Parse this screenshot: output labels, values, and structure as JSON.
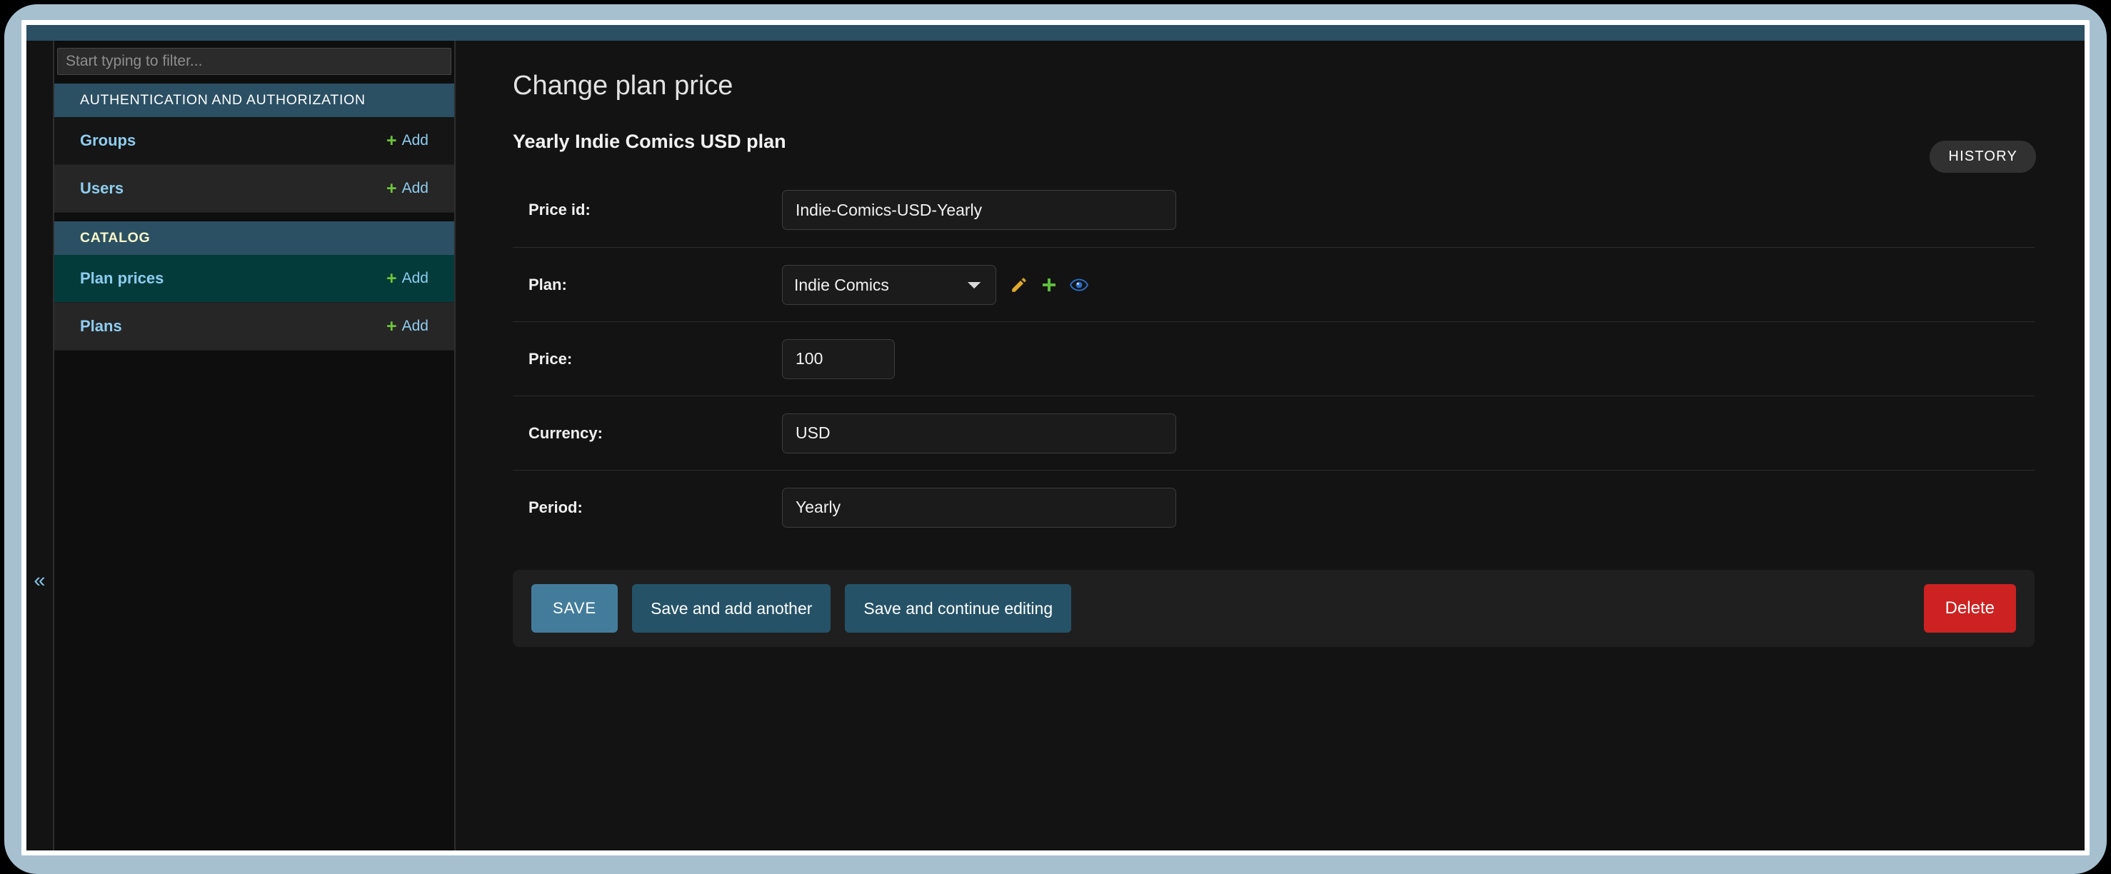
{
  "window": {
    "frame_color": "#a6c0d0",
    "header_strip_color": "#2b4f63"
  },
  "sidebar": {
    "filter_placeholder": "Start typing to filter...",
    "filter_value": "",
    "collapse_icon": "«",
    "add_label": "Add",
    "plus_glyph": "+",
    "groups": [
      {
        "header": "AUTHENTICATION AND AUTHORIZATION",
        "header_color": "#ffffff",
        "items": [
          {
            "label": "Groups",
            "add": "Add",
            "current": false
          },
          {
            "label": "Users",
            "add": "Add",
            "current": false
          }
        ]
      },
      {
        "header": "CATALOG",
        "header_color": "#f8f8c8",
        "items": [
          {
            "label": "Plan prices",
            "add": "Add",
            "current": true
          },
          {
            "label": "Plans",
            "add": "Add",
            "current": false
          }
        ]
      }
    ]
  },
  "main": {
    "page_title": "Change plan price",
    "history_label": "HISTORY",
    "object_subtitle": "Yearly Indie Comics USD plan",
    "fields": [
      {
        "key": "price_id",
        "label": "Price id:",
        "type": "text",
        "value": "Indie-Comics-USD-Yearly",
        "size": "wide"
      },
      {
        "key": "plan",
        "label": "Plan:",
        "type": "select",
        "value": "Indie Comics",
        "options": [
          "Indie Comics"
        ],
        "related_widgets": [
          {
            "name": "change-related-icon",
            "title": "Change selected plan",
            "color": "#e0a82e"
          },
          {
            "name": "add-related-icon",
            "title": "Add another plan",
            "color": "#5fbd3f"
          },
          {
            "name": "view-related-icon",
            "title": "View selected plan",
            "color": "#2a6fc4"
          }
        ]
      },
      {
        "key": "price",
        "label": "Price:",
        "type": "text",
        "value": "100",
        "size": "small"
      },
      {
        "key": "currency",
        "label": "Currency:",
        "type": "text",
        "value": "USD",
        "size": "wide"
      },
      {
        "key": "period",
        "label": "Period:",
        "type": "text",
        "value": "Yearly",
        "size": "wide"
      }
    ],
    "submit_row": {
      "save": "SAVE",
      "save_and_add_another": "Save and add another",
      "save_and_continue": "Save and continue editing",
      "delete": "Delete"
    }
  },
  "colors": {
    "accent_blue": "#8ecdf0",
    "section_header": "#2b4f63",
    "current_item": "#033b3b",
    "save_button": "#437c9b",
    "secondary_button": "#255267",
    "delete_button": "#cc2222",
    "plus_green": "#6ec43b"
  }
}
